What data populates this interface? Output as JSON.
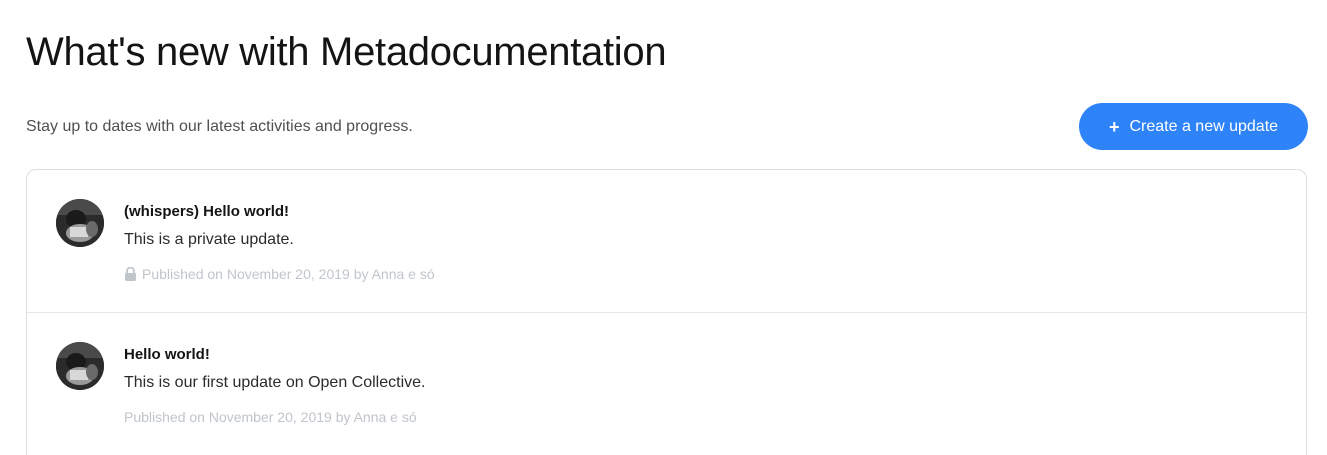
{
  "header": {
    "title": "What's new with Metadocumentation",
    "subtitle": "Stay up to dates with our latest activities and progress."
  },
  "actions": {
    "create_icon": "plus-icon",
    "create_label": "Create a new update",
    "accent_color": "#2e83f8"
  },
  "updates": [
    {
      "title": "(whispers) Hello world!",
      "body": "This is a private update.",
      "meta": "Published on November 20, 2019 by Anna e só",
      "private": true,
      "icon": "lock-icon"
    },
    {
      "title": "Hello world!",
      "body": "This is our first update on Open Collective.",
      "meta": "Published on November 20, 2019 by Anna e só",
      "private": false
    }
  ]
}
